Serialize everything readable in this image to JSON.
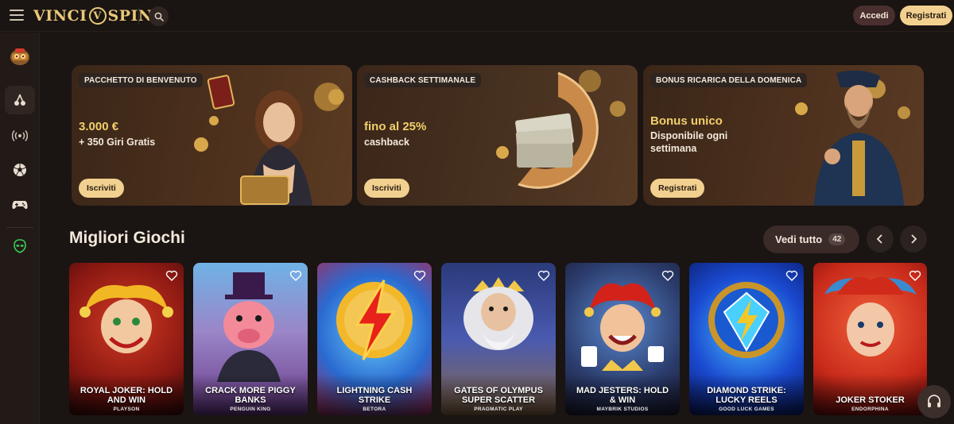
{
  "brand": {
    "logo_left": "VINCI",
    "logo_mid": "V",
    "logo_right": "SPIN"
  },
  "header": {
    "login_label": "Accedi",
    "register_label": "Registrati"
  },
  "sidebar": {
    "items": [
      {
        "icon": "casino-mascot-icon"
      },
      {
        "icon": "cherries-icon"
      },
      {
        "icon": "live-broadcast-icon"
      },
      {
        "icon": "soccer-ball-icon"
      },
      {
        "icon": "gamepad-icon"
      },
      {
        "icon": "alien-icon"
      }
    ]
  },
  "banners": [
    {
      "tag": "PACCHETTO DI BENVENUTO",
      "headline": "3.000 €",
      "sub": "+ 350 Giri Gratis",
      "cta": "Iscriviti"
    },
    {
      "tag": "CASHBACK SETTIMANALE",
      "headline": "fino al 25%",
      "sub": "cashback",
      "cta": "Iscriviti"
    },
    {
      "tag": "BONUS RICARICA DELLA DOMENICA",
      "headline": "Bonus unico",
      "sub1": "Disponibile ogni",
      "sub2": "settimana",
      "cta": "Registrati"
    }
  ],
  "top_games": {
    "title": "Migliori Giochi",
    "see_all_label": "Vedi tutto",
    "count": "42",
    "games": [
      {
        "name1": "ROYAL JOKER: HOLD",
        "name2": "AND WIN",
        "provider": "PLAYSON"
      },
      {
        "name1": "CRACK MORE PIGGY",
        "name2": "BANKS",
        "provider": "PENGUIN KING"
      },
      {
        "name1": "LIGHTNING CASH",
        "name2": "STRIKE",
        "provider": "BETORA"
      },
      {
        "name1": "GATES OF OLYMPUS",
        "name2": "SUPER SCATTER",
        "provider": "PRAGMATIC PLAY"
      },
      {
        "name1": "MAD JESTERS: HOLD",
        "name2": "& WIN",
        "provider": "MAYBRIK STUDIOS"
      },
      {
        "name1": "DIAMOND STRIKE:",
        "name2": "LUCKY REELS",
        "provider": "GOOD LUCK GAMES"
      },
      {
        "name1": "JOKER STOKER",
        "name2": "",
        "provider": "ENDORPHINA"
      }
    ]
  },
  "colors": {
    "accent": "#f2d190",
    "gold_text": "#f2cf6b",
    "background": "#1a1412"
  }
}
